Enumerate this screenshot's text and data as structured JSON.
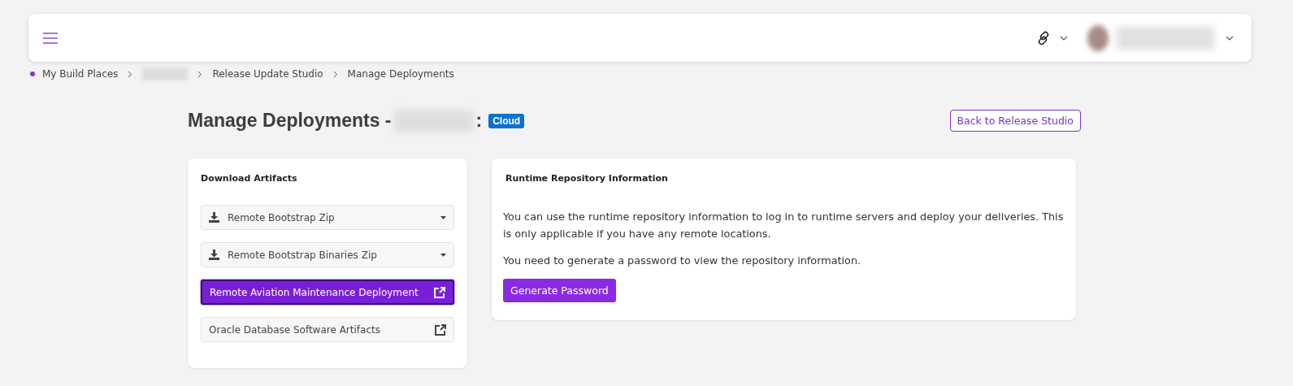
{
  "breadcrumb": [
    {
      "label": "My Build Places",
      "kind": "text"
    },
    {
      "kind": "blurred"
    },
    {
      "label": "Release Update Studio",
      "kind": "text"
    },
    {
      "label": "Manage Deployments",
      "kind": "text"
    }
  ],
  "page": {
    "title": "Manage Deployments -",
    "separator": ":",
    "badge": "Cloud",
    "back_button": "Back to Release Studio"
  },
  "artifacts": {
    "title": "Download Artifacts",
    "items": [
      {
        "label": "Remote Bootstrap Zip",
        "kind": "download",
        "selected": false
      },
      {
        "label": "Remote Bootstrap Binaries Zip",
        "kind": "download",
        "selected": false
      },
      {
        "label": "Remote Aviation Maintenance Deployment",
        "kind": "link",
        "selected": true
      },
      {
        "label": "Oracle Database Software Artifacts",
        "kind": "link",
        "selected": false
      }
    ]
  },
  "repository": {
    "title": "Runtime Repository Information",
    "paragraphs": [
      "You can use the runtime repository information to log in to runtime servers and deploy your deliveries. This is only applicable if you have any remote locations.",
      "You need to generate a password to view the repository information."
    ],
    "button": "Generate Password"
  }
}
